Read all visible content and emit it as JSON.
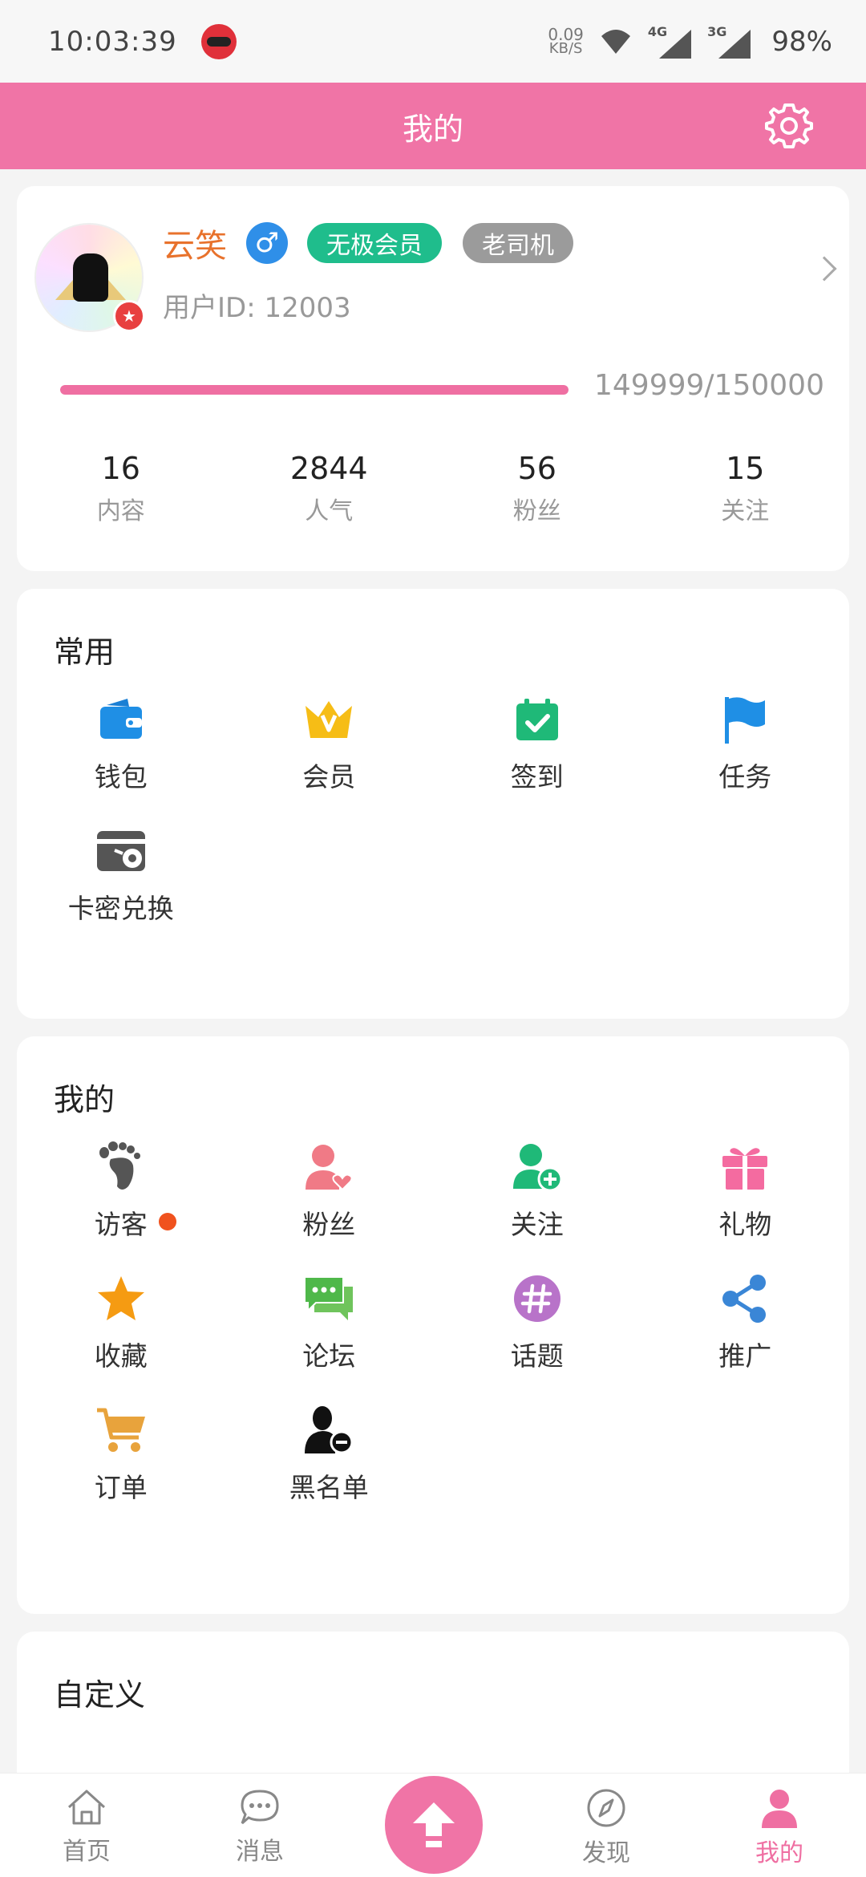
{
  "status_bar": {
    "time": "10:03:39",
    "net_speed": "0.09",
    "net_unit": "KB/S",
    "signal1": "4G",
    "signal2": "3G",
    "battery": "98%"
  },
  "header": {
    "title": "我的"
  },
  "profile": {
    "name": "云笑",
    "gender_symbol": "♂",
    "tags": [
      "无极会员",
      "老司机"
    ],
    "user_id": "用户ID: 12003",
    "progress_text": "149999/150000",
    "progress_fraction": 0.99999,
    "stats": [
      {
        "value": "16",
        "label": "内容"
      },
      {
        "value": "2844",
        "label": "人气"
      },
      {
        "value": "56",
        "label": "粉丝"
      },
      {
        "value": "15",
        "label": "关注"
      }
    ]
  },
  "common": {
    "title": "常用",
    "items": [
      {
        "label": "钱包",
        "icon": "wallet-icon"
      },
      {
        "label": "会员",
        "icon": "crown-icon"
      },
      {
        "label": "签到",
        "icon": "calendar-check-icon"
      },
      {
        "label": "任务",
        "icon": "flag-icon"
      },
      {
        "label": "卡密兑换",
        "icon": "card-key-icon"
      }
    ]
  },
  "mine": {
    "title": "我的",
    "items": [
      {
        "label": "访客",
        "icon": "footprint-icon"
      },
      {
        "label": "粉丝",
        "icon": "user-heart-icon"
      },
      {
        "label": "关注",
        "icon": "user-add-icon"
      },
      {
        "label": "礼物",
        "icon": "gift-icon"
      },
      {
        "label": "收藏",
        "icon": "star-icon"
      },
      {
        "label": "论坛",
        "icon": "chat-bubbles-icon"
      },
      {
        "label": "话题",
        "icon": "hashtag-icon"
      },
      {
        "label": "推广",
        "icon": "share-icon"
      },
      {
        "label": "订单",
        "icon": "cart-icon"
      },
      {
        "label": "黑名单",
        "icon": "user-block-icon"
      }
    ]
  },
  "custom": {
    "title": "自定义"
  },
  "bottom_nav": {
    "items": [
      {
        "label": "首页",
        "icon": "home-icon"
      },
      {
        "label": "消息",
        "icon": "message-icon"
      },
      {
        "label": "",
        "icon": "upload-icon"
      },
      {
        "label": "发现",
        "icon": "compass-icon"
      },
      {
        "label": "我的",
        "icon": "profile-icon"
      }
    ],
    "active_color": "#ef6fa2"
  },
  "colors": {
    "accent": "#f074a6",
    "vip_tag": "#1fbd8c",
    "driver_tag": "#9b9b9b",
    "username": "#e8722c"
  }
}
